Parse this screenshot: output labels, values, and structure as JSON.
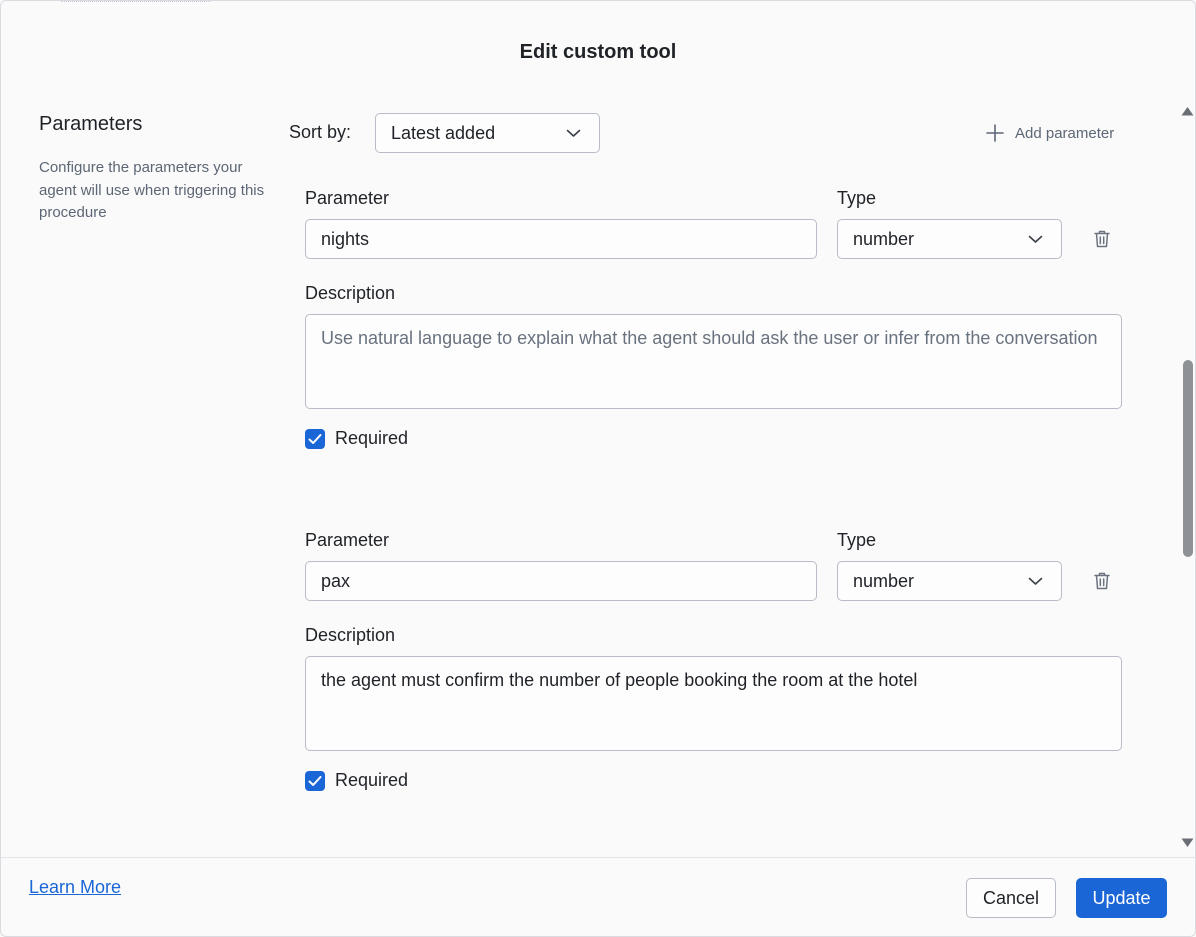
{
  "dialog": {
    "title": "Edit custom tool"
  },
  "sidebar": {
    "title": "Parameters",
    "description": "Configure the parameters your agent will use when triggering this procedure"
  },
  "toolbar": {
    "sort_label": "Sort by:",
    "sort_value": "Latest added",
    "add_parameter_label": "Add parameter"
  },
  "parameters": [
    {
      "parameter_label": "Parameter",
      "parameter_value": "nights",
      "type_label": "Type",
      "type_value": "number",
      "description_label": "Description",
      "description_value": "",
      "description_placeholder": "Use natural language to explain what the agent should ask the user or infer from the conversation",
      "required_label": "Required",
      "required": true
    },
    {
      "parameter_label": "Parameter",
      "parameter_value": "pax",
      "type_label": "Type",
      "type_value": "number",
      "description_label": "Description",
      "description_value": "the agent must confirm the number of people booking the room at the hotel",
      "description_placeholder": "",
      "required_label": "Required",
      "required": true
    }
  ],
  "footer": {
    "learn_more": "Learn More",
    "cancel": "Cancel",
    "update": "Update"
  },
  "colors": {
    "accent": "#1a66d6",
    "background": "#fafafa",
    "border": "#b8bcc6"
  },
  "icons": [
    "chevron-down-icon",
    "plus-icon",
    "trash-icon",
    "checkmark-icon",
    "scroll-up-arrow-icon",
    "scroll-down-arrow-icon"
  ]
}
